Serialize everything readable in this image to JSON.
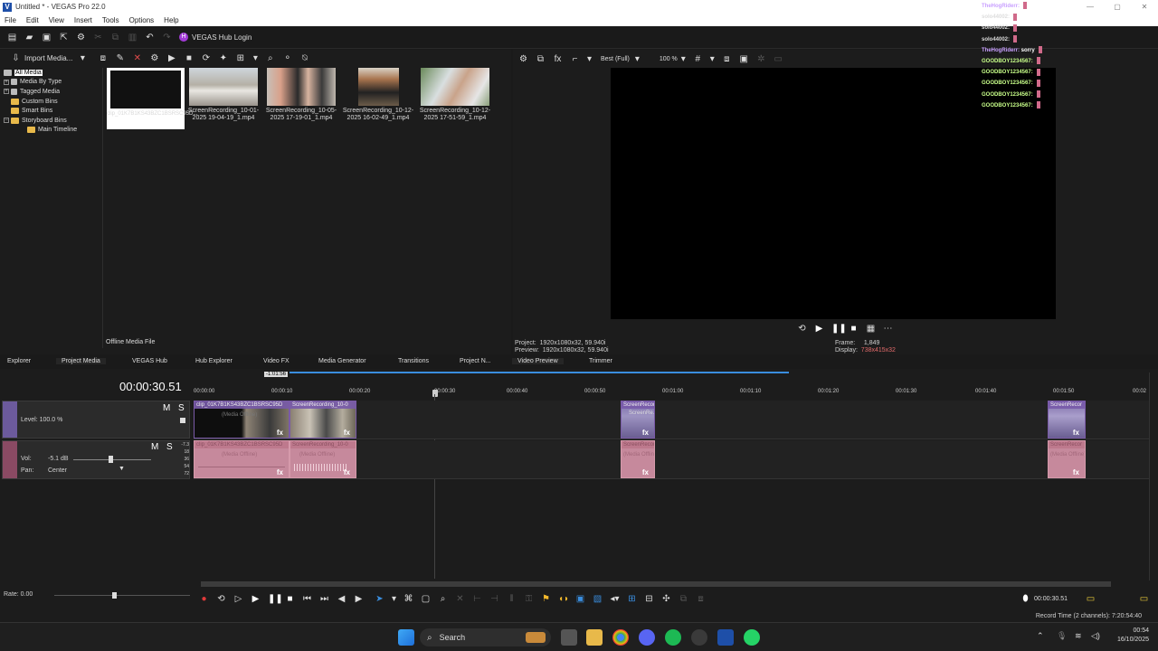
{
  "window": {
    "title": "Untitled * - VEGAS Pro 22.0",
    "minimize": "—",
    "maximize": "▢",
    "close": "✕"
  },
  "menu": [
    "File",
    "Edit",
    "View",
    "Insert",
    "Tools",
    "Options",
    "Help"
  ],
  "toolbar": {
    "hub_login": "VEGAS Hub Login"
  },
  "project_media": {
    "import_label": "Import Media...",
    "tree": [
      "All Media",
      "Media By Type",
      "Tagged Media",
      "Custom Bins",
      "Smart Bins",
      "Storyboard Bins",
      "Main Timeline"
    ],
    "thumbs": [
      {
        "caption": "clip_01K7B1KS43BZC1BSRSC95D..."
      },
      {
        "caption": "ScreenRecording_10-01-2025 19-04-19_1.mp4"
      },
      {
        "caption": "ScreenRecording_10-05-2025 17-19-01_1.mp4"
      },
      {
        "caption": "ScreenRecording_10-12-2025 16-02-49_1.mp4"
      },
      {
        "caption": "ScreenRecording_10-12-2025 17-51-59_1.mp4"
      }
    ],
    "status": "Offline Media File"
  },
  "preview": {
    "quality": "Best (Full)",
    "zoom": "100 %",
    "project_label": "Project:",
    "project_value": "1920x1080x32, 59.940i",
    "preview_label": "Preview:",
    "preview_value": "1920x1080x32, 59.940i",
    "frame_label": "Frame:",
    "frame_value": "1,849",
    "display_label": "Display:",
    "display_value": "738x415x32"
  },
  "tabs": [
    "Explorer",
    "Project Media",
    "VEGAS Hub",
    "Hub Explorer",
    "Video FX",
    "Media Generator",
    "Transitions",
    "Project N...",
    "Video Preview",
    "Trimmer"
  ],
  "timeline": {
    "timecode": "00:00:30.51",
    "loop_marker": "-1:01:56",
    "ruler": [
      "00:00:00",
      "00:00:10",
      "00:00:20",
      "00:00:30",
      "00:00:40",
      "00:00:50",
      "00:01:00",
      "00:01:10",
      "00:01:20",
      "00:01:30",
      "00:01:40",
      "00:01:50",
      "00:02"
    ],
    "video_track": {
      "m": "M",
      "s": "S",
      "level": "Level: 100.0 %"
    },
    "audio_track": {
      "m": "M",
      "s": "S",
      "vol_label": "Vol:",
      "vol_value": "-5.1 dB",
      "pan_label": "Pan:",
      "pan_value": "Center",
      "meter": [
        "-7.3",
        "18",
        "36",
        "54",
        "72"
      ]
    },
    "video_clips": [
      {
        "name": "clip_01K7B1KS43BZC1BSRSC95D",
        "sub": "(Media Offline)"
      },
      {
        "name": "ScreenRecording_10-0",
        "sub": ""
      },
      {
        "name": "ScreenRecor",
        "sub": "ScreenRe..."
      },
      {
        "name": "ScreenRecor",
        "sub": ""
      }
    ],
    "audio_clips": [
      {
        "name": "clip_01K7B1KS43BZC1BSRSC95D",
        "sub": "(Media Offline)"
      },
      {
        "name": "ScreenRecording_10-0",
        "sub": "(Media Offline)"
      },
      {
        "name": "ScreenRecor",
        "sub": "(Media Offline)"
      },
      {
        "name": "ScreenRecor",
        "sub": "(Media Offline)"
      }
    ],
    "fx": "fx"
  },
  "transport": {
    "rate": "Rate: 0.00",
    "end_time": "00:00:30.51"
  },
  "status": {
    "record_time": "Record Time (2 channels): 7:20:54:40"
  },
  "chat": [
    {
      "user": "TheHogRiderr:",
      "msg": "",
      "color": "#c9a0ff"
    },
    {
      "user": "solo44002:",
      "msg": "",
      "color": "#ddd"
    },
    {
      "user": "solo44002:",
      "msg": "",
      "color": "#ddd"
    },
    {
      "user": "solo44002:",
      "msg": "",
      "color": "#ddd"
    },
    {
      "user": "TheHogRiderr:",
      "msg": "sorry",
      "color": "#c9a0ff"
    },
    {
      "user": "GOODBOY1234567:",
      "msg": "",
      "color": "#c8ff8a"
    },
    {
      "user": "GOODBOY1234567:",
      "msg": "",
      "color": "#c8ff8a"
    },
    {
      "user": "GOODBOY1234567:",
      "msg": "",
      "color": "#c8ff8a"
    },
    {
      "user": "GOODBOY1234567:",
      "msg": "",
      "color": "#c8ff8a"
    },
    {
      "user": "GOODBOY1234567:",
      "msg": "",
      "color": "#c8ff8a"
    }
  ],
  "taskbar": {
    "search": "Search",
    "time": "00:54",
    "date": "16/10/2025"
  }
}
